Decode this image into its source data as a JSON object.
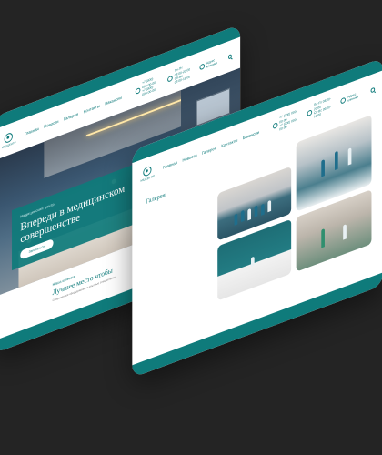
{
  "colors": {
    "background": "#242424",
    "brand": "#0f7b7b",
    "card": "#ffffff"
  },
  "header": {
    "logo_text": "МЕДЦЕНТР",
    "nav": [
      "Главная",
      "Новости",
      "Галерея",
      "Контакты",
      "Вакансии"
    ],
    "contacts": [
      {
        "icon": "phone-icon",
        "line1": "+7 (000) 000-00-00",
        "line2": "+7 (000) 000-00-00"
      },
      {
        "icon": "clock-icon",
        "line1": "Пн-Пт 08:00-20:00",
        "line2": "Сб-Вс 09:00-18:00"
      },
      {
        "icon": "location-icon",
        "line1": "Адрес клиники",
        "line2": ""
      }
    ]
  },
  "hero": {
    "kicker": "Медицинский центр",
    "title": "Впереди в медицинском совершенстве",
    "button": "Записаться"
  },
  "about": {
    "kicker": "Наша клиника",
    "title": "Лучшее место чтобы",
    "text": "Современное оборудование и опытные специалисты"
  },
  "gallery": {
    "title": "Галерея"
  }
}
